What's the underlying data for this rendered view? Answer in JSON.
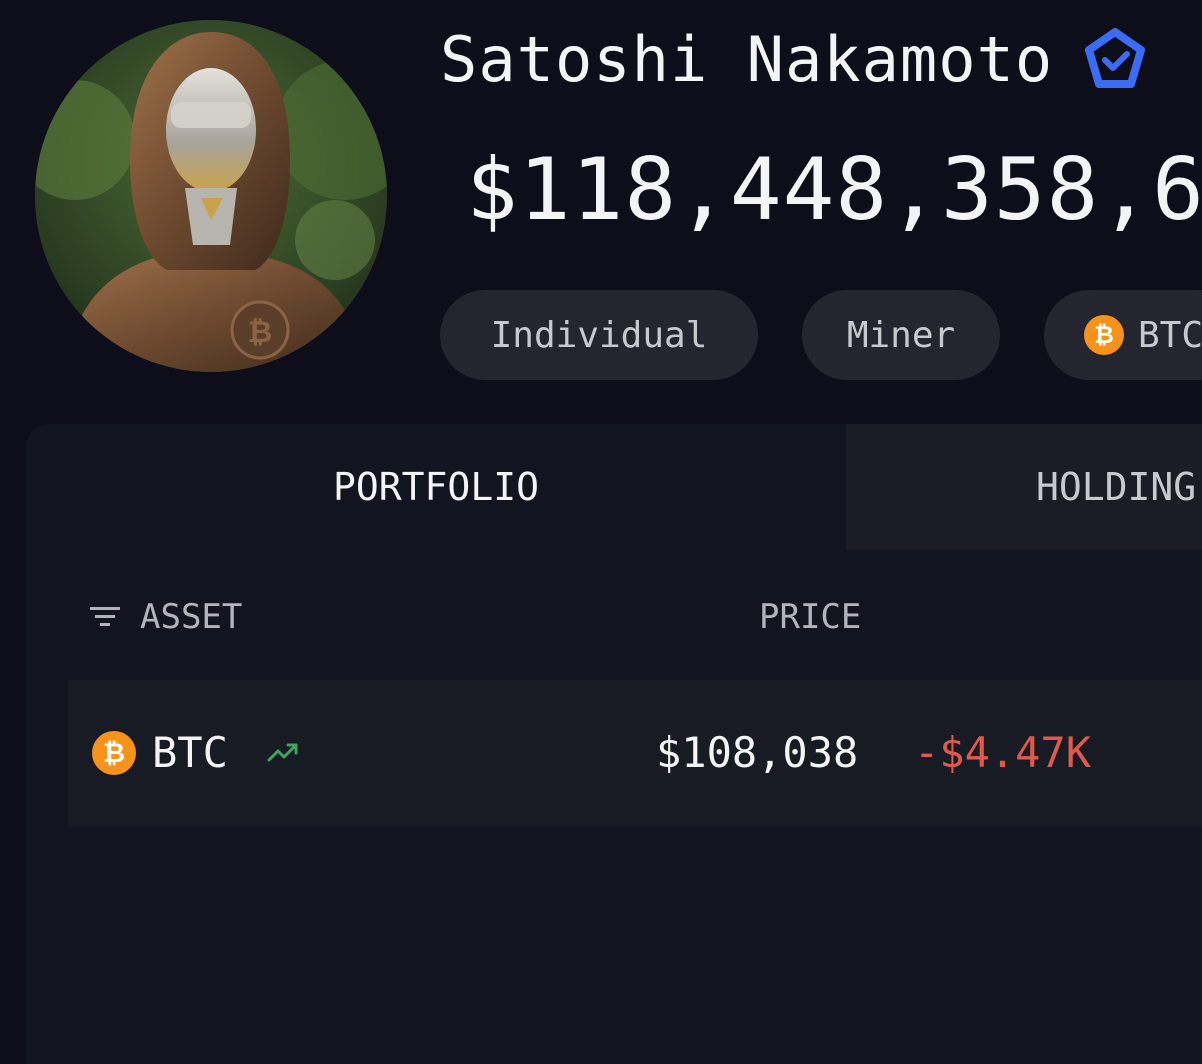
{
  "entity": {
    "name": "Satoshi Nakamoto",
    "balance": "$118,448,358,6",
    "verified_icon": "verified-badge-icon",
    "tags": [
      {
        "label": "Individual"
      },
      {
        "label": "Miner"
      },
      {
        "label": "BTC",
        "icon": "bitcoin-icon"
      }
    ]
  },
  "tabs": {
    "portfolio": "PORTFOLIO",
    "holdings": "HOLDING"
  },
  "table": {
    "headers": {
      "asset": "ASSET",
      "price": "PRICE"
    },
    "rows": [
      {
        "symbol": "BTC",
        "coin_glyph": "₿",
        "price": "$108,038",
        "change": "-$4.47K",
        "trend": "trending-up-icon"
      }
    ]
  },
  "colors": {
    "background": "#0d0e1a",
    "panel": "#121420",
    "bitcoin": "#f7931a",
    "negative": "#e05a4c",
    "positive": "#3fa55e",
    "verified": "#3b6cf6"
  }
}
